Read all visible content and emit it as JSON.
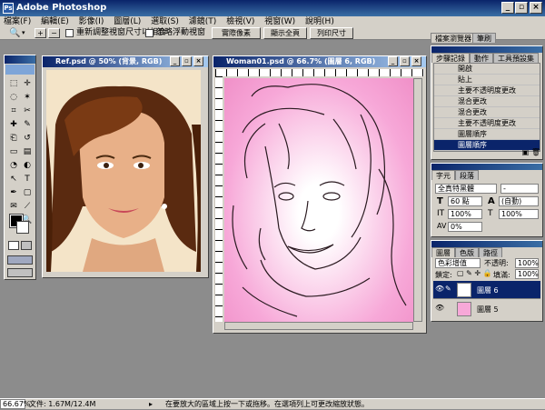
{
  "app": {
    "title": "Adobe Photoshop"
  },
  "menu": [
    "檔案(F)",
    "編輯(E)",
    "影像(I)",
    "圖層(L)",
    "選取(S)",
    "濾鏡(T)",
    "檢視(V)",
    "視窗(W)",
    "說明(H)"
  ],
  "options": {
    "resize_label": "重新調整視窗尺寸以相合",
    "ignore_label": "忽略浮動視窗",
    "btn_actual": "實際像素",
    "btn_fit": "顯示全頁",
    "btn_print": "列印尺寸",
    "tab_browser": "檔案瀏覽器",
    "tab_brushes": "筆刷"
  },
  "doc1": {
    "title": "Ref.psd @ 50% (背景, RGB)"
  },
  "doc2": {
    "title": "Woman01.psd @ 66.7% (圖層 6, RGB)"
  },
  "history": {
    "tabs": [
      "步驟記錄",
      "動作",
      "工具預設集"
    ],
    "items": [
      "開啟",
      "貼上",
      "主要不透明度更改",
      "混合更改",
      "混合更改",
      "主要不透明度更改",
      "圖層順序",
      "圖層順序"
    ]
  },
  "character": {
    "tabs": [
      "字元",
      "段落"
    ],
    "font": "全真特黑體",
    "style": "-",
    "size": "60 點",
    "leading": "(自動)",
    "scale_v": "100%",
    "scale_h": "100%",
    "tracking": "0%",
    "size_icon": "T",
    "leading_icon": "A"
  },
  "layers": {
    "tabs": [
      "圖層",
      "色版",
      "路徑"
    ],
    "blend": "色彩增值",
    "opacity_label": "不透明:",
    "opacity": "100%",
    "lock_label": "鎖定:",
    "fill_label": "填滿:",
    "fill": "100%",
    "items": [
      "圖層 6",
      "圖層 5"
    ]
  },
  "status": {
    "zoom": "66.67%",
    "doc": "文件: 1.67M/12.4M",
    "hint": "在要放大的區域上按一下或拖移。在選項列上可更改縮放狀態。"
  },
  "colors": {
    "titlebar": "#0a246a",
    "selection": "#0a246a",
    "canvas_pink": "#f7a8d8",
    "face_bg": "#f4e4c8"
  }
}
